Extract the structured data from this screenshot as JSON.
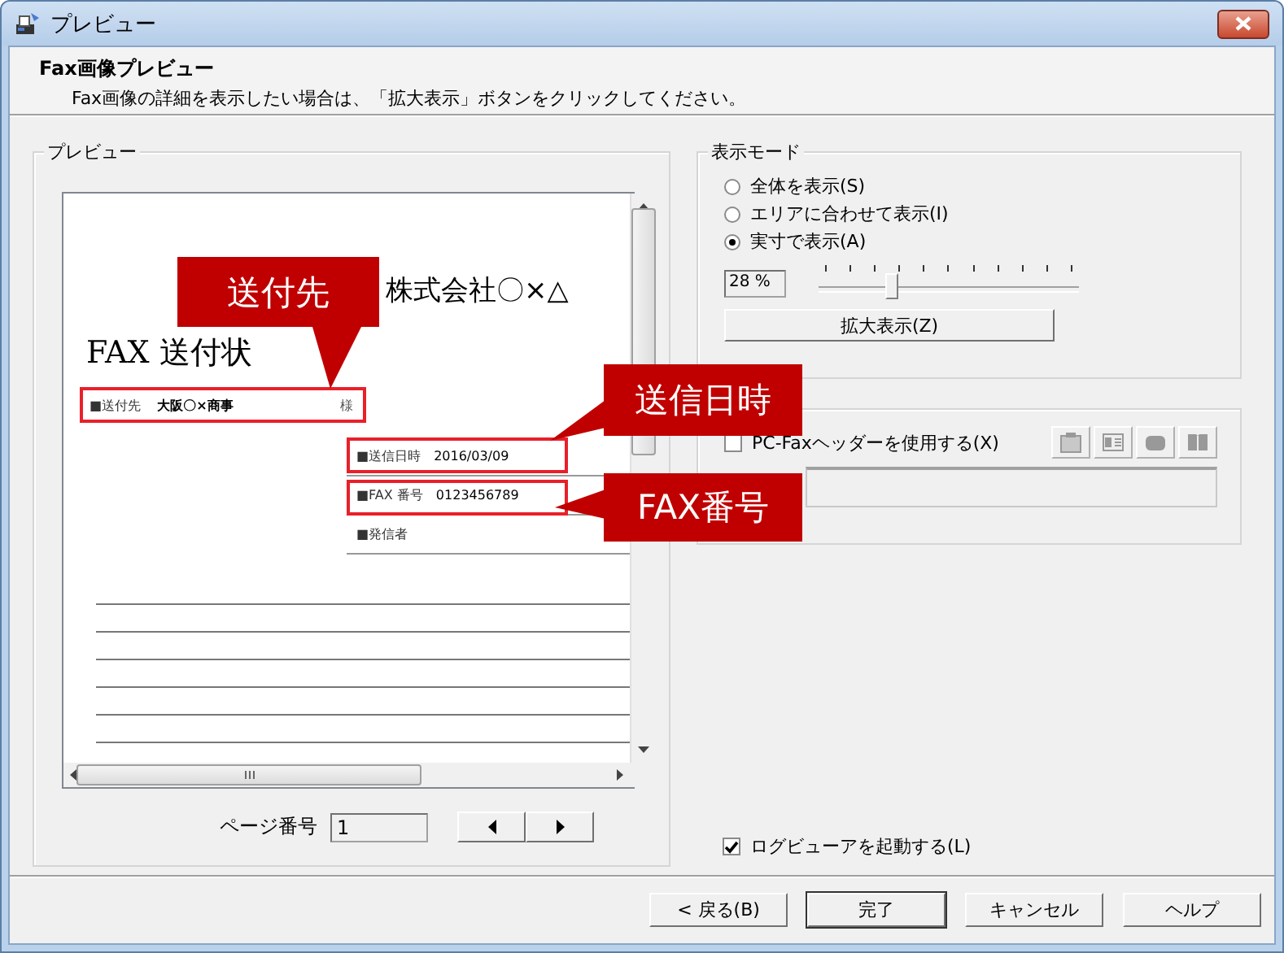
{
  "window": {
    "title": "プレビュー"
  },
  "header": {
    "title": "Fax画像プレビュー",
    "description": "Fax画像の詳細を表示したい場合は、「拡大表示」ボタンをクリックしてください。"
  },
  "preview": {
    "label": "プレビュー",
    "document": {
      "company": "株式会社〇×△",
      "title": "FAX 送付状",
      "recipient": {
        "label": "■送付先",
        "value": "大阪〇×商事",
        "suffix": "様"
      },
      "fields": [
        {
          "label": "■送信日時",
          "value": "2016/03/09"
        },
        {
          "label": "■FAX 番号",
          "value": "0123456789"
        },
        {
          "label": "■発信者"
        }
      ]
    },
    "page_number": {
      "label": "ページ番号",
      "value": "1"
    }
  },
  "callouts": [
    {
      "text": "送付先"
    },
    {
      "text": "送信日時"
    },
    {
      "text": "FAX番号"
    }
  ],
  "display_mode": {
    "label": "表示モード",
    "options": [
      {
        "label": "全体を表示(S)",
        "selected": false
      },
      {
        "label": "エリアに合わせて表示(I)",
        "selected": false
      },
      {
        "label": "実寸で表示(A)",
        "selected": true
      }
    ],
    "zoom": {
      "value": "28 %",
      "level": 0.28
    },
    "zoom_button": "拡大表示(Z)"
  },
  "fax_header": {
    "label": "PC-Faxヘッダーを使用する(X)",
    "checked": false
  },
  "log_viewer": {
    "label": "ログビューアを起動する(L)",
    "checked": true
  },
  "buttons": [
    {
      "label": "< 戻る(B)",
      "default": false
    },
    {
      "label": "完了",
      "default": true
    },
    {
      "label": "キャンセル",
      "default": false
    },
    {
      "label": "ヘルプ",
      "default": false
    }
  ]
}
